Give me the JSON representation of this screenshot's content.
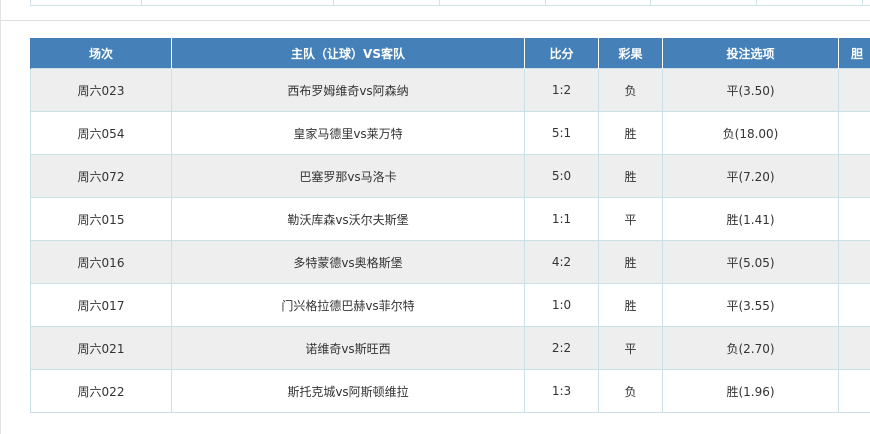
{
  "table": {
    "headers": {
      "match_no": "场次",
      "teams": "主队（让球）VS客队",
      "score": "比分",
      "result": "彩果",
      "bet_option": "投注选项",
      "extra": "胆"
    },
    "rows": [
      {
        "match_no": "周六023",
        "teams": "西布罗姆维奇vs阿森纳",
        "score": "1:2",
        "result": "负",
        "bet_option": "平(3.50)",
        "extra": ""
      },
      {
        "match_no": "周六054",
        "teams": "皇家马德里vs莱万特",
        "score": "5:1",
        "result": "胜",
        "bet_option": "负(18.00)",
        "extra": ""
      },
      {
        "match_no": "周六072",
        "teams": "巴塞罗那vs马洛卡",
        "score": "5:0",
        "result": "胜",
        "bet_option": "平(7.20)",
        "extra": ""
      },
      {
        "match_no": "周六015",
        "teams": "勒沃库森vs沃尔夫斯堡",
        "score": "1:1",
        "result": "平",
        "bet_option": "胜(1.41)",
        "extra": ""
      },
      {
        "match_no": "周六016",
        "teams": "多特蒙德vs奥格斯堡",
        "score": "4:2",
        "result": "胜",
        "bet_option": "平(5.05)",
        "extra": ""
      },
      {
        "match_no": "周六017",
        "teams": "门兴格拉德巴赫vs菲尔特",
        "score": "1:0",
        "result": "胜",
        "bet_option": "平(3.55)",
        "extra": ""
      },
      {
        "match_no": "周六021",
        "teams": "诺维奇vs斯旺西",
        "score": "2:2",
        "result": "平",
        "bet_option": "负(2.70)",
        "extra": ""
      },
      {
        "match_no": "周六022",
        "teams": "斯托克城vs阿斯顿维拉",
        "score": "1:3",
        "result": "负",
        "bet_option": "胜(1.96)",
        "extra": ""
      }
    ]
  }
}
